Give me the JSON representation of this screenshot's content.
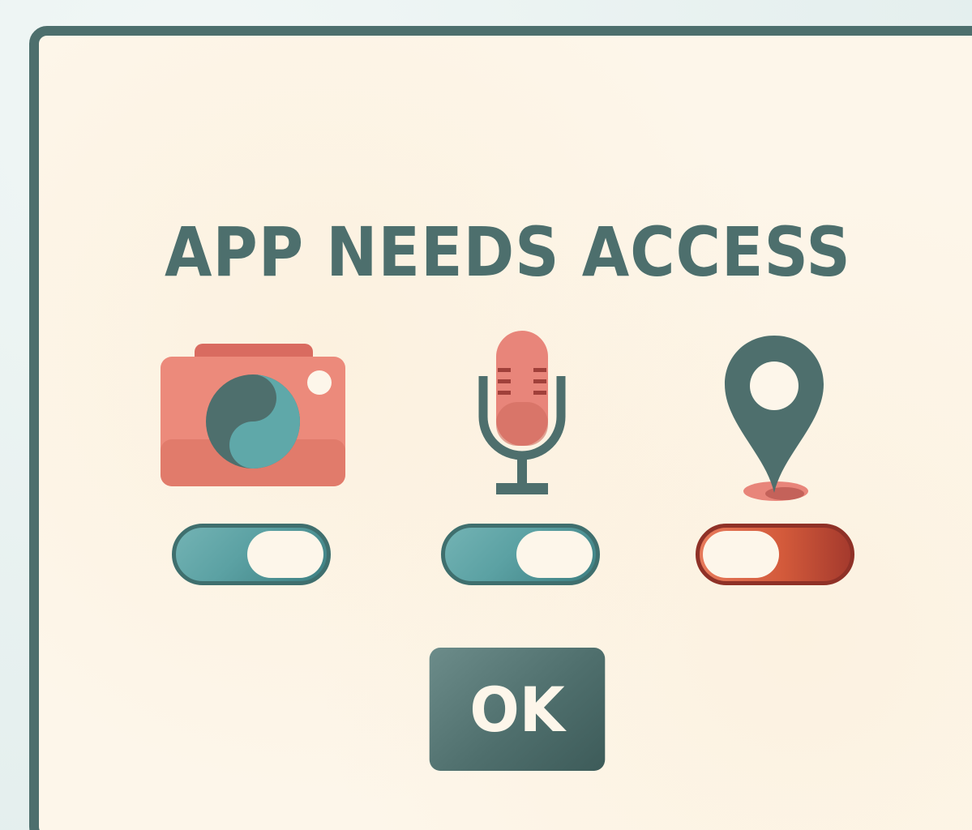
{
  "dialog": {
    "title": "APP NEEDS ACCESS",
    "ok_label": "OK"
  },
  "permissions": [
    {
      "id": "camera",
      "icon": "camera-icon",
      "enabled": true
    },
    {
      "id": "microphone",
      "icon": "microphone-icon",
      "enabled": true
    },
    {
      "id": "location",
      "icon": "location-pin-icon",
      "enabled": false
    }
  ],
  "colors": {
    "frame": "#4d6f6d",
    "panel": "#fdf6ea",
    "accent_teal": "#5ba1a3",
    "accent_coral": "#e77a6c",
    "accent_red": "#c24f35"
  }
}
